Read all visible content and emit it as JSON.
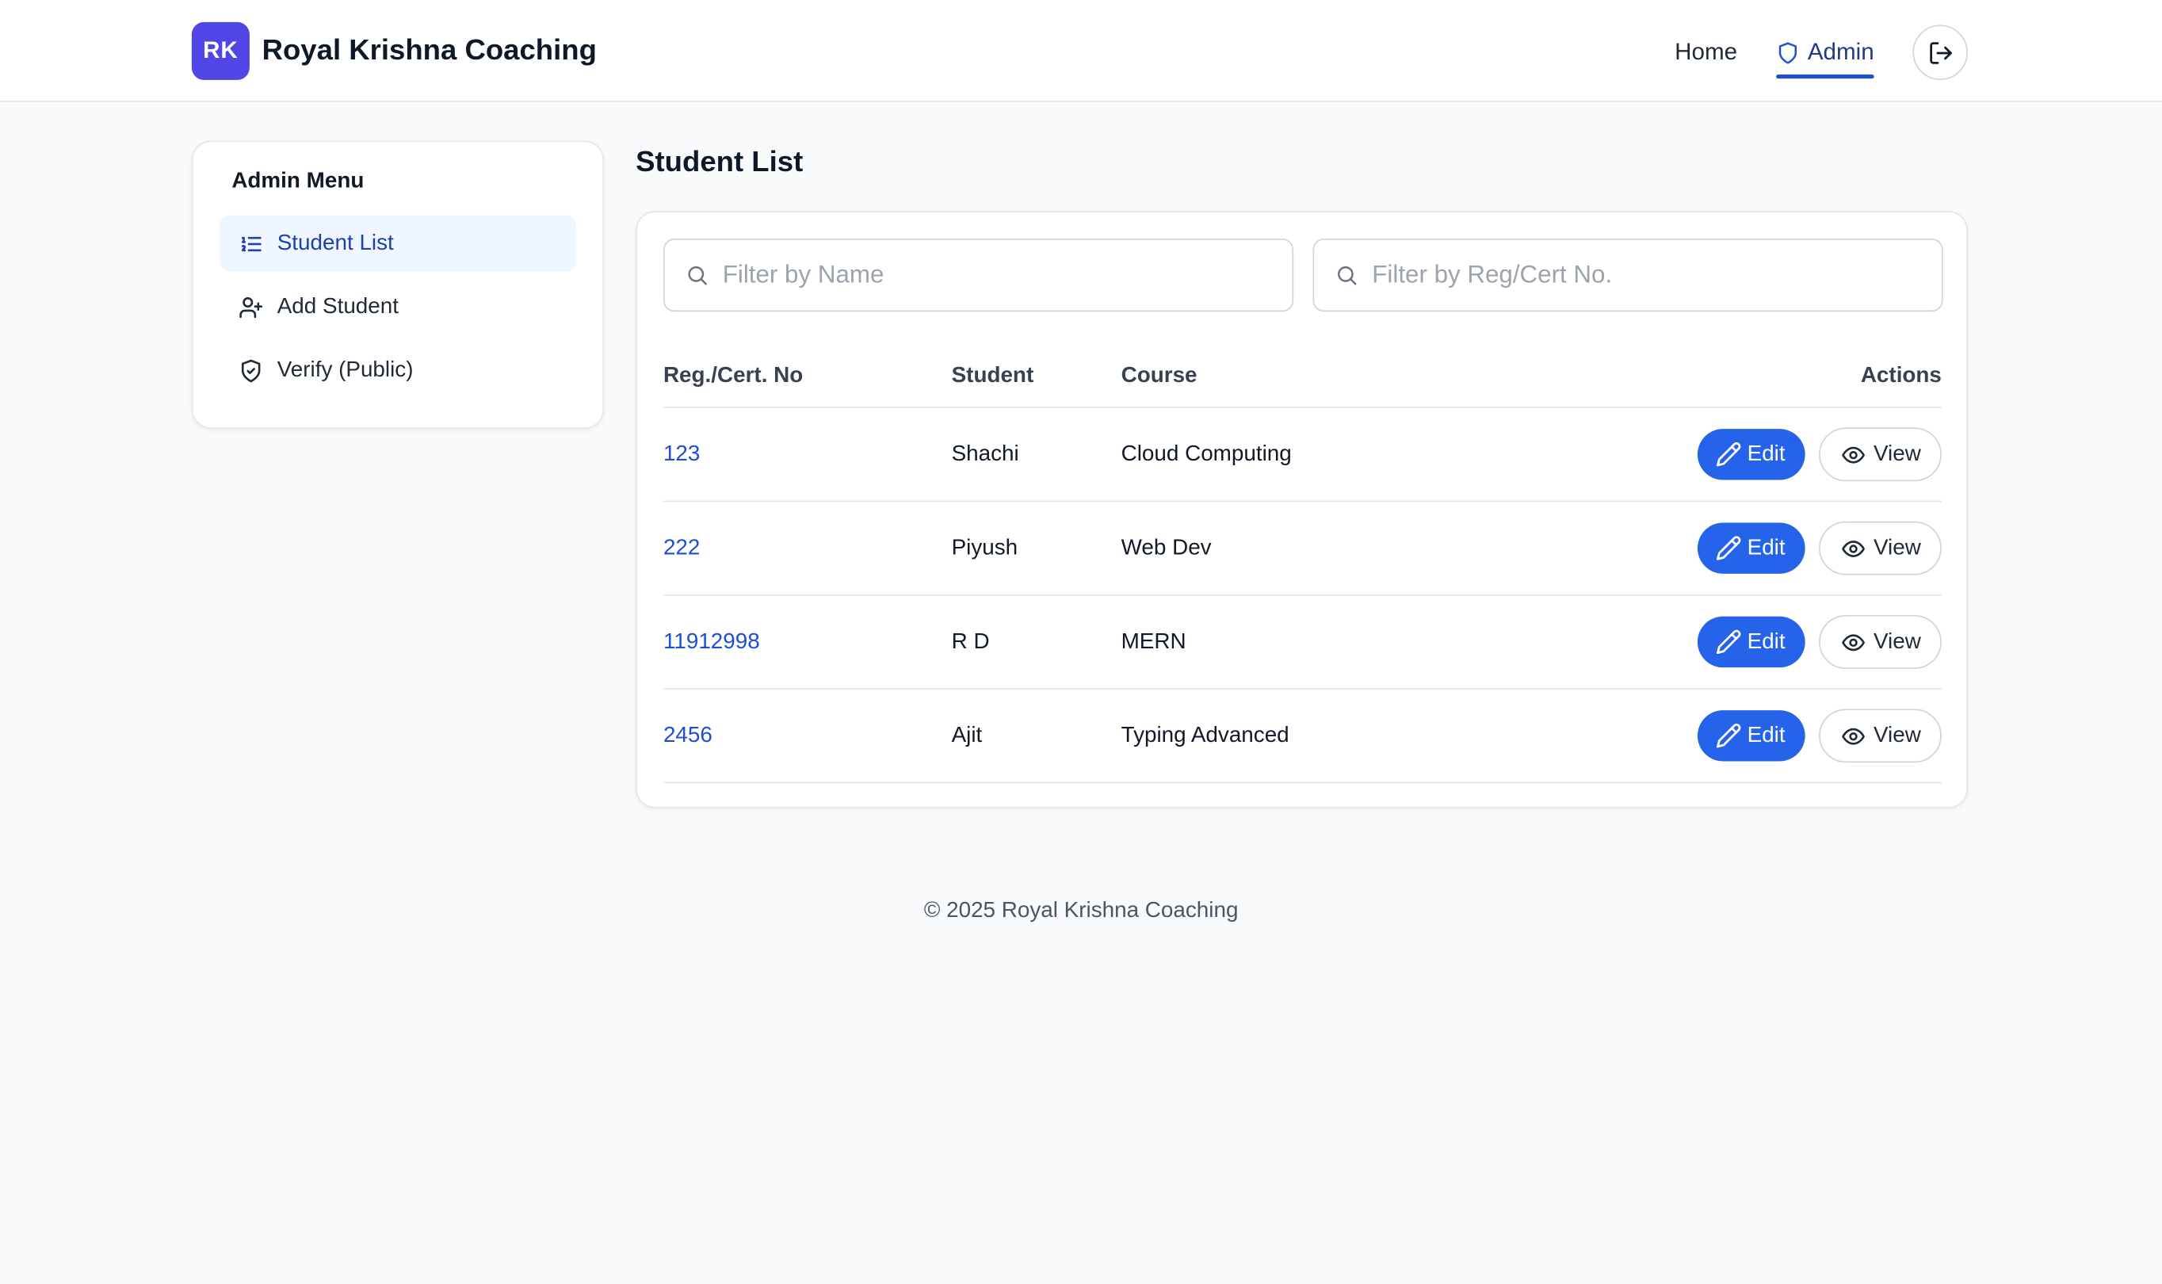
{
  "brand": {
    "logo_text": "RK",
    "name": "Royal Krishna Coaching",
    "logo_color": "#4f46e5"
  },
  "nav": {
    "home": "Home",
    "admin": "Admin",
    "logout_icon": "logout-icon"
  },
  "sidebar": {
    "title": "Admin Menu",
    "items": [
      {
        "label": "Student List",
        "icon": "list-icon",
        "active": true
      },
      {
        "label": "Add Student",
        "icon": "user-plus-icon",
        "active": false
      },
      {
        "label": "Verify (Public)",
        "icon": "shield-check-icon",
        "active": false
      }
    ]
  },
  "main": {
    "title": "Student List",
    "filters": {
      "name_placeholder": "Filter by Name",
      "reg_placeholder": "Filter by Reg/Cert No.",
      "name_value": "",
      "reg_value": ""
    },
    "table": {
      "headers": [
        "Reg./Cert. No",
        "Student",
        "Course",
        "Actions"
      ],
      "rows": [
        {
          "reg": "123",
          "student": "Shachi",
          "course": "Cloud Computing"
        },
        {
          "reg": "222",
          "student": "Piyush",
          "course": "Web Dev"
        },
        {
          "reg": "11912998",
          "student": "R D",
          "course": "MERN"
        },
        {
          "reg": "2456",
          "student": "Ajit",
          "course": "Typing Advanced"
        }
      ],
      "edit_label": "Edit",
      "view_label": "View"
    }
  },
  "footer": {
    "text": "© 2025 Royal Krishna Coaching"
  },
  "colors": {
    "accent": "#2563eb",
    "link": "#1d4ed8",
    "active_bg": "#eff6ff"
  }
}
